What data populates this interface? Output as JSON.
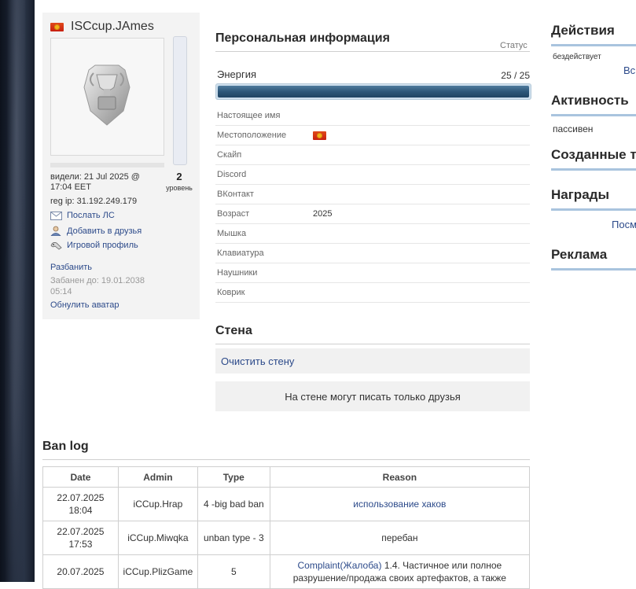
{
  "profile": {
    "username": "ISCcup.JAmes",
    "seen": "видели: 21 Jul 2025 @ 17:04 EET",
    "reg_ip": "reg ip: 31.192.249.179",
    "level": "2",
    "level_label": "уровень",
    "actions": [
      "Послать ЛС",
      "Добавить в друзья",
      "Игровой профиль"
    ],
    "unban": "Разбанить",
    "banned_until": "Забанен до: 19.01.2038 05:14",
    "reset_avatar": "Обнулить аватар"
  },
  "personal": {
    "title": "Персональная информация",
    "status_label": "Статус",
    "energy_label": "Энергия",
    "energy_value": "25 / 25",
    "energy_fraction": 1.0,
    "rows": [
      {
        "label": "Настоящее имя",
        "value": ""
      },
      {
        "label": "Местоположение",
        "value": ""
      },
      {
        "label": "Скайп",
        "value": ""
      },
      {
        "label": "Discord",
        "value": ""
      },
      {
        "label": "ВКонтакт",
        "value": ""
      },
      {
        "label": "Возраст",
        "value": "2025"
      },
      {
        "label": "Мышка",
        "value": ""
      },
      {
        "label": "Клавиатура",
        "value": ""
      },
      {
        "label": "Наушники",
        "value": ""
      },
      {
        "label": "Коврик",
        "value": ""
      }
    ]
  },
  "wall": {
    "title": "Стена",
    "clear": "Очистить стену",
    "note": "На стене могут писать только друзья"
  },
  "banlog": {
    "title": "Ban log",
    "headers": [
      "Date",
      "Admin",
      "Type",
      "Reason"
    ],
    "rows": [
      {
        "date": "22.07.2025 18:04",
        "admin": "iCCup.Hrap",
        "type": "4 -big bad ban",
        "reason_link": "использование хаков",
        "reason_text": ""
      },
      {
        "date": "22.07.2025 17:53",
        "admin": "iCCup.Miwqka",
        "type": "unban type - 3",
        "reason_link": "",
        "reason_text": "перебан"
      },
      {
        "date": "20.07.2025",
        "admin": "iCCup.PlizGame",
        "type": "5",
        "reason_link": "Complaint(Жалоба)",
        "reason_text": " 1.4. Частичное или полное разрушение/продажа своих артефактов, а также"
      }
    ]
  },
  "sidebar": {
    "actions_title": "Действия",
    "actions_status": "бездействует",
    "actions_link": "Вс",
    "activity_title": "Активность",
    "activity_status": "пассивен",
    "created_title": "Созданные т",
    "awards_title": "Награды",
    "awards_link": "Посм",
    "ads_title": "Реклама"
  },
  "colors": {
    "link": "#2c4a8a",
    "energy_bar": "#2d5779",
    "accent_line": "#a9c4de"
  }
}
